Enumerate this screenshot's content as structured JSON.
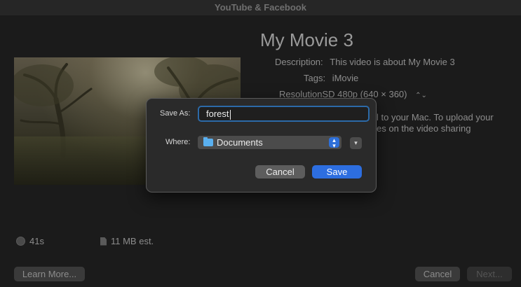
{
  "window": {
    "title": "YouTube & Facebook"
  },
  "movie": {
    "title": "My Movie 3",
    "description_label": "Description:",
    "description": "This video is about My Movie 3",
    "tags_label": "Tags:",
    "tags": "iMovie",
    "resolution_label": "Resolution",
    "resolution": "SD 480p (640 × 360)",
    "resolution_stepper": "⌃⌄",
    "info_line1": "l to your Mac. To upload your",
    "info_line2": "es on the video sharing"
  },
  "stats": {
    "duration": "41s",
    "size": "11 MB est."
  },
  "footer": {
    "learn_more": "Learn More...",
    "cancel": "Cancel",
    "next": "Next..."
  },
  "save_dialog": {
    "save_as_label": "Save As:",
    "save_as_value": "forest",
    "where_label": "Where:",
    "where_value": "Documents",
    "cancel_label": "Cancel",
    "save_label": "Save",
    "accent_color": "#2d6ee0"
  }
}
